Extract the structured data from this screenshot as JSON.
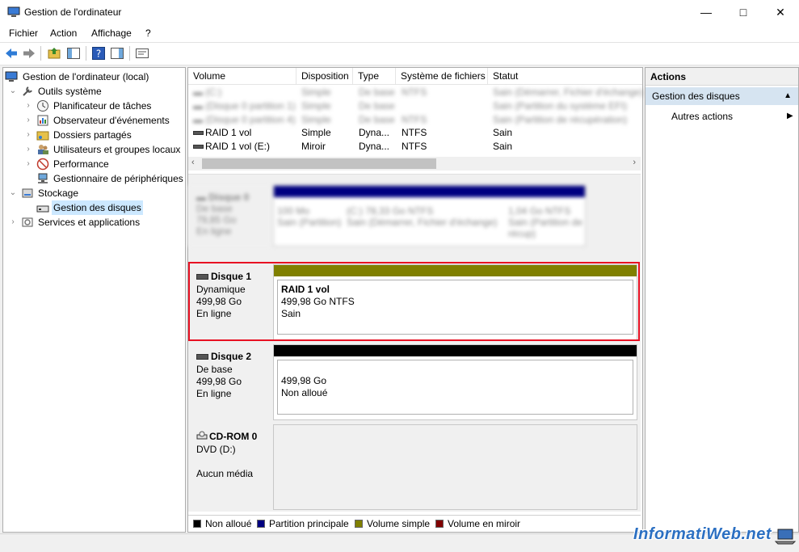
{
  "window": {
    "title": "Gestion de l'ordinateur"
  },
  "menu": [
    "Fichier",
    "Action",
    "Affichage",
    "?"
  ],
  "tree": {
    "root": "Gestion de l'ordinateur (local)",
    "system_tools": "Outils système",
    "task_scheduler": "Planificateur de tâches",
    "event_viewer": "Observateur d'événements",
    "shared_folders": "Dossiers partagés",
    "users_groups": "Utilisateurs et groupes locaux",
    "performance": "Performance",
    "device_manager": "Gestionnaire de périphériques",
    "storage": "Stockage",
    "disk_management": "Gestion des disques",
    "services": "Services et applications"
  },
  "volumes": {
    "columns": [
      "Volume",
      "Disposition",
      "Type",
      "Système de fichiers",
      "Statut"
    ],
    "rows": [
      {
        "volume": "RAID 1 vol",
        "layout": "Simple",
        "type": "Dyna...",
        "fs": "NTFS",
        "status": "Sain"
      },
      {
        "volume": "RAID 1 vol (E:)",
        "layout": "Miroir",
        "type": "Dyna...",
        "fs": "NTFS",
        "status": "Sain"
      }
    ]
  },
  "disks": {
    "disk1": {
      "name": "Disque 1",
      "kind": "Dynamique",
      "size": "499,98 Go",
      "state": "En ligne",
      "partition": {
        "title": "RAID 1 vol",
        "detail": "499,98 Go NTFS",
        "status": "Sain"
      }
    },
    "disk2": {
      "name": "Disque 2",
      "kind": "De base",
      "size": "499,98 Go",
      "state": "En ligne",
      "partition": {
        "detail": "499,98 Go",
        "status": "Non alloué"
      }
    },
    "cdrom": {
      "name": "CD-ROM 0",
      "kind": "DVD (D:)",
      "state": "Aucun média"
    }
  },
  "legend": {
    "unallocated": "Non alloué",
    "primary": "Partition principale",
    "simple": "Volume simple",
    "mirror": "Volume en miroir"
  },
  "actions": {
    "title": "Actions",
    "section": "Gestion des disques",
    "more": "Autres actions"
  },
  "watermark": "InformatiWeb.net",
  "colors": {
    "unallocated": "#000000",
    "primary": "#000080",
    "simple": "#808000",
    "mirror": "#800000",
    "highlight": "#e81123",
    "selection": "#cce8ff"
  }
}
